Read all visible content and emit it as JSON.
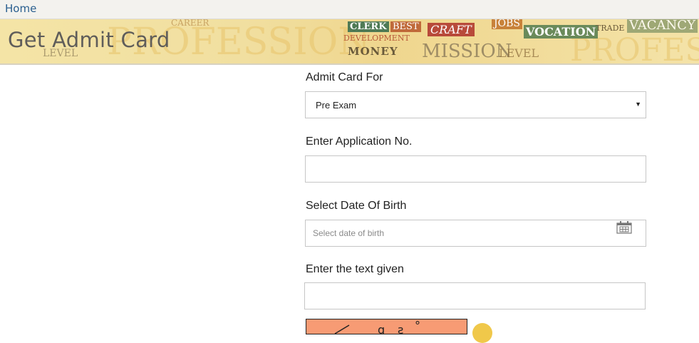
{
  "nav": {
    "home": "Home"
  },
  "banner": {
    "title": "Get Admit Card",
    "words": [
      "PROFESSION",
      "PROFES",
      "CLERK",
      "BEST",
      "VOCATION",
      "MONEY",
      "MISSION",
      "LEVEL",
      "CRAFT",
      "TRADE",
      "VACANCY",
      "DEVELOPMENT",
      "LEVEL",
      "JOBS",
      "CAREER"
    ]
  },
  "form": {
    "admit_label": "Admit Card For",
    "admit_value": "Pre Exam",
    "application_label": "Enter Application No.",
    "application_value": "",
    "dob_label": "Select Date Of Birth",
    "dob_placeholder": "Select date of birth",
    "captcha_label": "Enter the text given",
    "captcha_value": ""
  },
  "icons": {
    "calendar": "calendar-icon",
    "dropdown": "dropdown-arrow-icon",
    "refresh": "refresh-icon"
  },
  "colors": {
    "link": "#2a5f8f",
    "banner": "#f1dfa0",
    "captcha_bg": "#f79b74"
  }
}
